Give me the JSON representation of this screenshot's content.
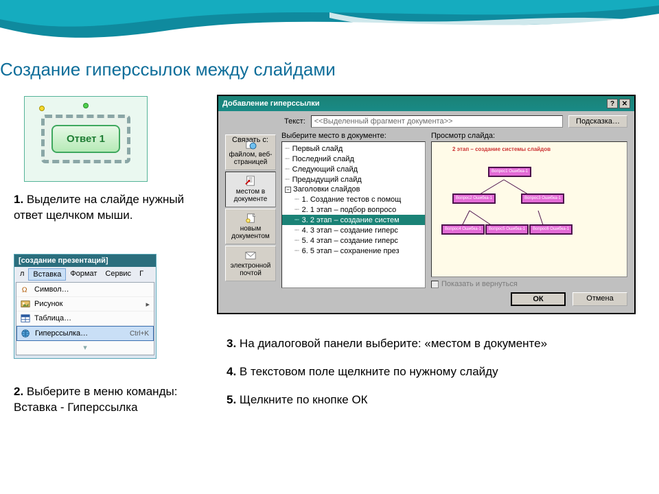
{
  "title": "Создание гиперссылок между слайдами",
  "answer_button": "Ответ 1",
  "steps": {
    "s1_num": "1.",
    "s1": "Выделите на слайде нужный ответ щелчком мыши.",
    "s2_num": "2.",
    "s2": "Выберите в меню команды:",
    "s2b": "Вставка - Гиперссылка",
    "s3_num": "3.",
    "s3": "На диалоговой панели выберите: «местом в документе»",
    "s4_num": "4.",
    "s4": "В текстовом поле щелкните по нужному слайду",
    "s5_num": "5.",
    "s5": "Щелкните по кнопке ОК"
  },
  "menu": {
    "window_title": "[создание презентаций]",
    "bar": {
      "file_letter": "л",
      "insert": "Вставка",
      "format": "Формат",
      "tools": "Сервис",
      "e": "Г"
    },
    "items": {
      "symbol": "Символ…",
      "picture": "Рисунок",
      "table": "Таблица…",
      "hyperlink": "Гиперссылка…",
      "shortcut": "Ctrl+K"
    }
  },
  "dialog": {
    "title": "Добавление гиперссылки",
    "linkwith": "Связать с:",
    "text_lbl": "Текст:",
    "text_placeholder": "<<Выделенный фрагмент документа>>",
    "hint_btn": "Подсказка…",
    "linkbar": {
      "file": "файлом, веб-страницей",
      "place": "местом в документе",
      "newdoc": "новым документом",
      "email": "электронной почтой"
    },
    "tree_lbl": "Выберите место в документе:",
    "tree": {
      "first": "Первый слайд",
      "last": "Последний слайд",
      "next": "Следующий слайд",
      "prev": "Предыдущий слайд",
      "headers": "Заголовки слайдов",
      "i1": "1. Создание тестов с помощ",
      "i2": "2. 1 этап – подбор вопросо",
      "i3": "3. 2 этап – создание систем",
      "i4": "4. 3 этап – создание гиперс",
      "i5": "5. 4 этап – создание гиперс",
      "i6": "6. 5 этап – сохранение през"
    },
    "preview_lbl": "Просмотр слайда:",
    "preview_title": "2 этап – создание системы слайдов",
    "nodes": {
      "n1": "Вопрос1 Ошибка-1",
      "n2": "Вопрос2 Ошибка-1",
      "n3": "Вопрос3 Ошибка-1",
      "n4": "Вопрос4 Ошибка-1",
      "n5": "Вопрос5 Ошибка-1",
      "n6": "Вопрос6 Ошибка-1"
    },
    "show_return": "Показать и вернуться",
    "ok": "ОК",
    "cancel": "Отмена"
  }
}
